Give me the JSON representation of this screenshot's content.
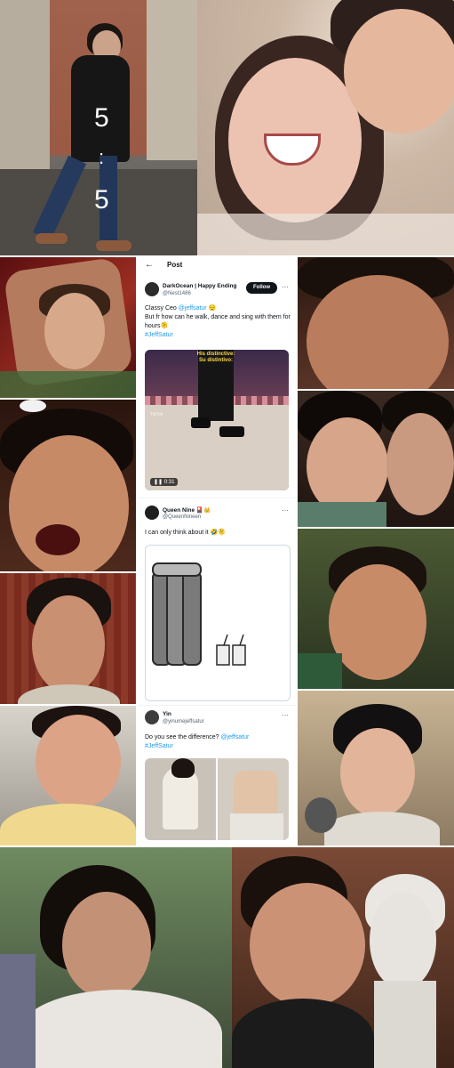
{
  "overlay": {
    "top": "5",
    "dot": ":",
    "bottom": "5"
  },
  "post_header": {
    "title": "Post",
    "back_icon": "back-arrow-icon"
  },
  "tweets": [
    {
      "display_name": "DarkOcean | Happy Ending",
      "handle": "@Nest1486",
      "follow_label": "Follow",
      "line1": "Classy Ceo ",
      "mention": "@jeffsatur",
      "line1_emoji": " 😌",
      "line2": "But fr how can he walk, dance and sing with them for hours🫠",
      "hashtag": "#JeffSatur",
      "video": {
        "caption_en": "His distinctive:",
        "caption_es": "Su distintivo:",
        "duration": "0:31",
        "watermark": "TikTok"
      }
    },
    {
      "display_name": "Queen Nine 🎴👑",
      "handle": "@QueenNineen",
      "text": "I can only think about it 🤣🫠"
    },
    {
      "display_name": "Yin",
      "handle": "@yinumejeffsatur",
      "text": "Do you see the difference? ",
      "mention": "@jeffsatur",
      "hashtag": "#JeffSatur"
    }
  ],
  "colors": {
    "link": "#1d9bf0",
    "text": "#0f1419",
    "muted": "#536471",
    "follow_bg": "#0f1419"
  },
  "icons": [
    "back-arrow-icon",
    "more-options-icon",
    "play-pause-icon"
  ]
}
